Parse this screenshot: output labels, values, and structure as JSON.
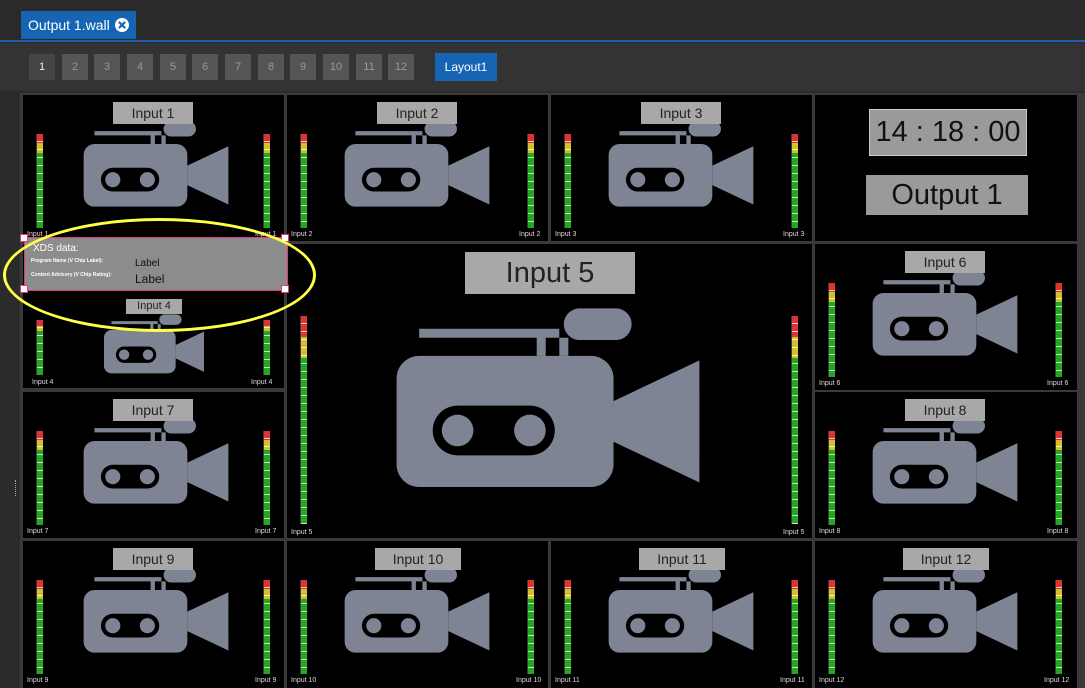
{
  "tab": {
    "title": "Output 1.wall",
    "close_icon": "close-circle-icon"
  },
  "pages": {
    "items": [
      "1",
      "2",
      "3",
      "4",
      "5",
      "6",
      "7",
      "8",
      "9",
      "10",
      "11",
      "12"
    ],
    "active": "1",
    "layout_label": "Layout1"
  },
  "inputs": {
    "in1": {
      "title": "Input 1",
      "left_label": "Input 1",
      "right_label": "Input 1"
    },
    "in2": {
      "title": "Input 2",
      "left_label": "Input 2",
      "right_label": "Input 2"
    },
    "in3": {
      "title": "Input 3",
      "left_label": "Input 3",
      "right_label": "Input 3"
    },
    "in4": {
      "title": "Input 4",
      "left_label": "Input 4",
      "right_label": "Input 4"
    },
    "in5": {
      "title": "Input 5",
      "left_label": "Input 5",
      "right_label": "Input 5"
    },
    "in6": {
      "title": "Input 6",
      "left_label": "Input 6",
      "right_label": "Input 6"
    },
    "in7": {
      "title": "Input 7",
      "left_label": "Input 7",
      "right_label": "Input 7"
    },
    "in8": {
      "title": "Input 8",
      "left_label": "Input 8",
      "right_label": "Input 8"
    },
    "in9": {
      "title": "Input 9",
      "left_label": "Input 9",
      "right_label": "Input 9"
    },
    "in10": {
      "title": "Input 10",
      "left_label": "Input 10",
      "right_label": "Input 10"
    },
    "in11": {
      "title": "Input 11",
      "left_label": "Input 11",
      "right_label": "Input 11"
    },
    "in12": {
      "title": "Input 12",
      "left_label": "Input 12",
      "right_label": "Input 12"
    }
  },
  "output": {
    "clock": "14 : 18 : 00",
    "name": "Output 1"
  },
  "xds": {
    "heading": "XDS data:",
    "program_name_key": "Program Name (V Chip Label):",
    "content_advisory_key": "Content Advisory (V Chip Rating):",
    "program_name_value": "Label",
    "content_advisory_value": "Label"
  },
  "colors": {
    "accent": "#1565b4",
    "highlight": "#ffff45",
    "selection": "#e0377f",
    "camera": "#7e8494",
    "meter_green": "#23a823",
    "meter_yellow": "#d4c02a",
    "meter_red": "#d33"
  },
  "icons": {
    "camera": "video-camera-icon",
    "meter": "audio-level-meter"
  }
}
